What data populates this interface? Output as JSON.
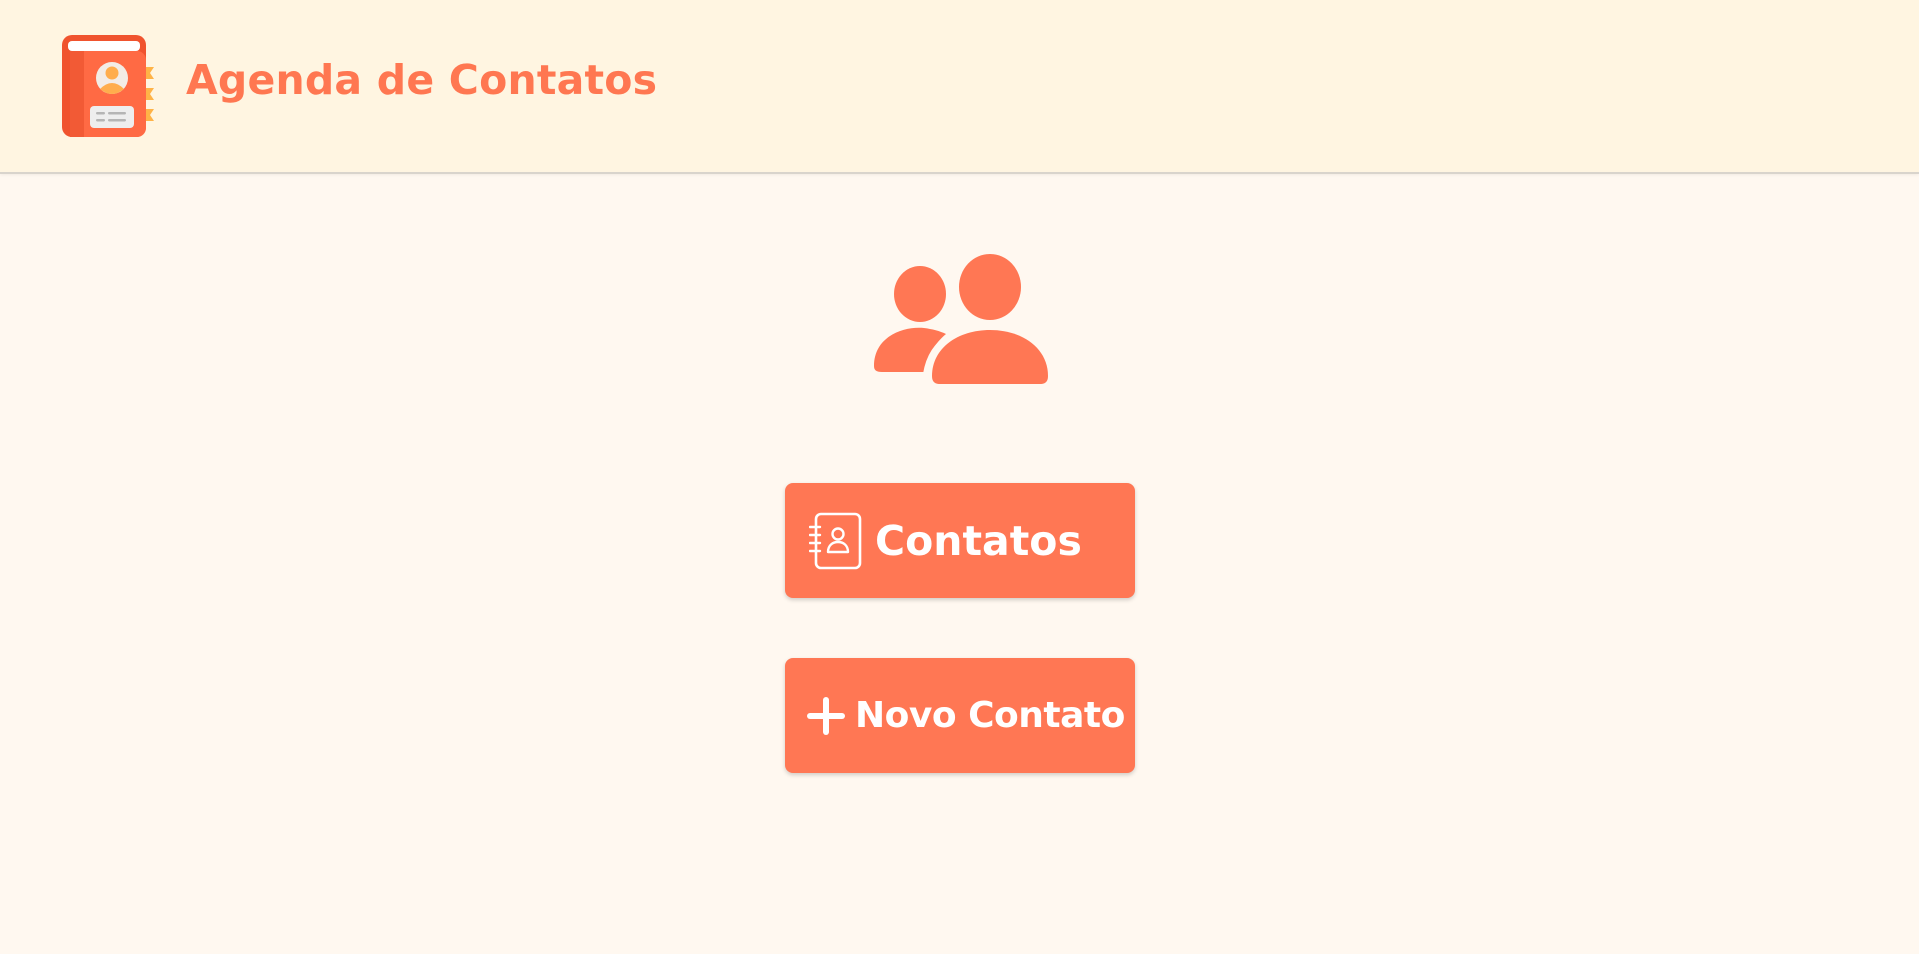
{
  "header": {
    "app_title": "Agenda de Contatos",
    "logo_icon": "address-book-icon"
  },
  "hero": {
    "icon": "users-icon"
  },
  "actions": {
    "contatos_label": "Contatos",
    "contatos_icon": "contact-book-icon",
    "novo_contato_label": "Novo Contato",
    "novo_contato_icon": "plus-icon"
  },
  "colors": {
    "accent": "#ff7754",
    "header_bg": "#fff5e1",
    "page_bg": "#fff8f0",
    "button_text": "#ffffff"
  }
}
